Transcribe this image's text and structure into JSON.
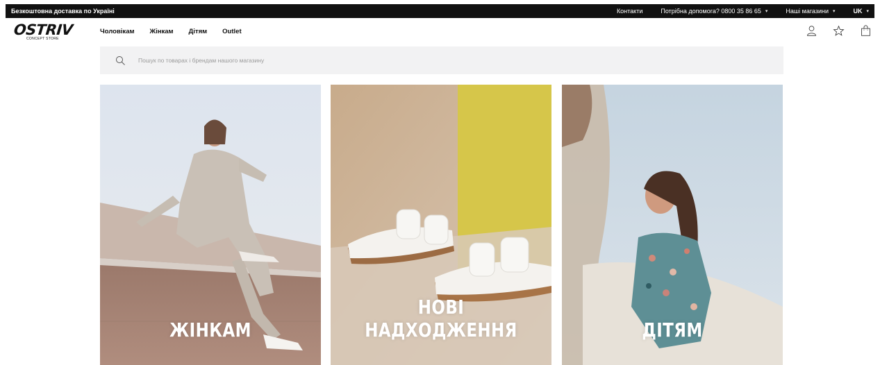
{
  "topbar": {
    "shipping": "Безкоштовна доставка по Україні",
    "contacts": "Контакти",
    "help": "Потрібна допомога? 0800 35 86 65",
    "stores": "Наші магазини",
    "lang": "UK"
  },
  "logo": {
    "name": "OSTRIV",
    "subtitle": "CONCEPT STORE"
  },
  "nav": {
    "men": "Чоловікам",
    "women": "Жінкам",
    "kids": "Дітям",
    "outlet": "Outlet"
  },
  "icons": [
    "user-icon",
    "star-icon",
    "bag-icon"
  ],
  "search": {
    "placeholder": "Пошук по товарах і брендам нашого магазину"
  },
  "tiles": [
    {
      "caption": "ЖІНКАМ"
    },
    {
      "caption": "НОВІ НАДХОДЖЕННЯ"
    },
    {
      "caption": "ДІТЯМ"
    }
  ],
  "colors": {
    "topbar_bg": "#111111",
    "search_bg": "#f2f2f3",
    "accent_yellow": "#d6c64a",
    "sand": "#cfb79b"
  }
}
